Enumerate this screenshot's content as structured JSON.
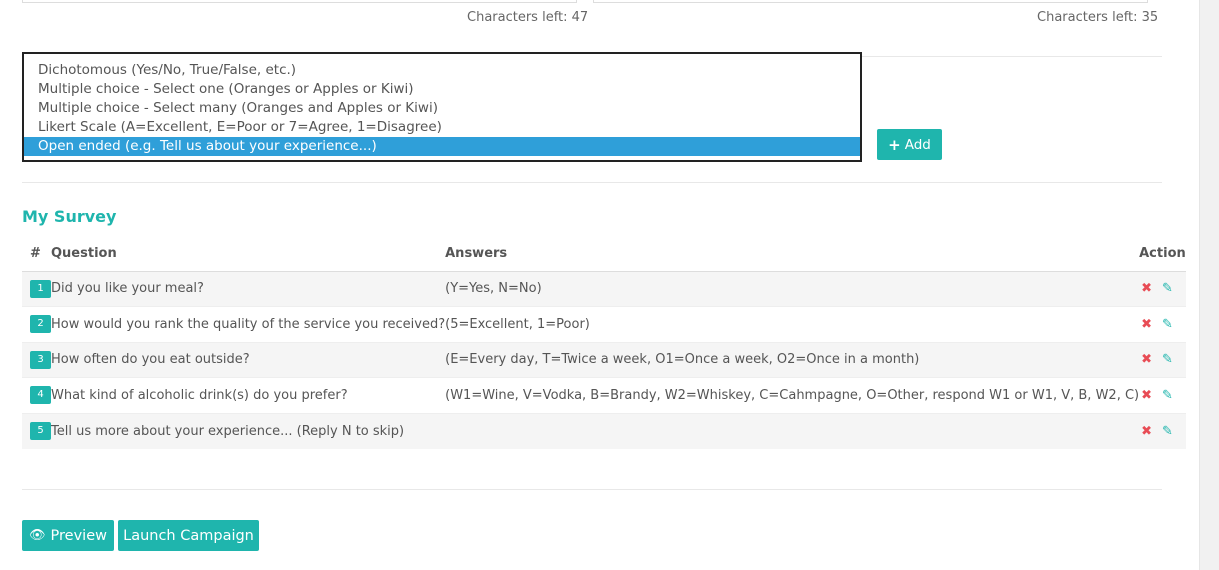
{
  "counters": {
    "left_label": "Characters left: 47",
    "right_label": "Characters left: 35"
  },
  "question_types": {
    "options": [
      "Dichotomous (Yes/No, True/False, etc.)",
      "Multiple choice - Select one (Oranges or Apples or Kiwi)",
      "Multiple choice - Select many (Oranges and Apples or Kiwi)",
      "Likert Scale (A=Excellent, E=Poor or 7=Agree, 1=Disagree)",
      "Open ended (e.g. Tell us about your experience...)"
    ],
    "selected": "Open ended (e.g. Tell us about your experience...)"
  },
  "add_button": {
    "icon": "plus-icon",
    "label": "Add"
  },
  "survey": {
    "title": "My Survey",
    "headers": {
      "num": "#",
      "question": "Question",
      "answers": "Answers",
      "action": "Action"
    },
    "rows": [
      {
        "num": "1",
        "question": "Did you like your meal?",
        "answers": "(Y=Yes, N=No)"
      },
      {
        "num": "2",
        "question": "How would you rank the quality of the service you received?",
        "answers": "(5=Excellent, 1=Poor)"
      },
      {
        "num": "3",
        "question": "How often do you eat outside?",
        "answers": "(E=Every day, T=Twice a week, O1=Once a week, O2=Once in a month)"
      },
      {
        "num": "4",
        "question": "What kind of alcoholic drink(s) do you prefer?",
        "answers": "(W1=Wine, V=Vodka, B=Brandy, W2=Whiskey, C=Cahmpagne, O=Other, respond W1 or W1, V, B, W2, C)"
      },
      {
        "num": "5",
        "question": "Tell us more about your experience... (Reply N to skip)",
        "answers": ""
      }
    ],
    "row_action_icons": [
      "delete-icon",
      "edit-icon"
    ]
  },
  "footer": {
    "preview_icon": "eye-icon",
    "preview_label": "Preview",
    "launch_label": "Launch Campaign"
  },
  "colors": {
    "accent": "#1fb5ad",
    "selected": "#2f9fd9",
    "delete": "#e84c55"
  }
}
